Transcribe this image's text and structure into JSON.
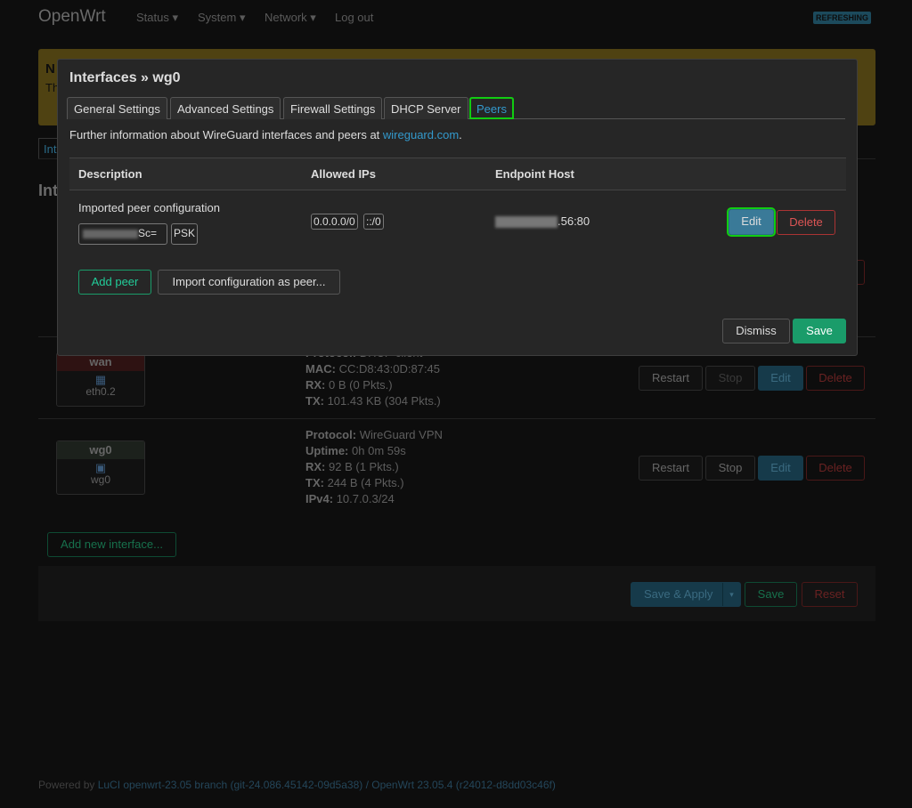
{
  "header": {
    "brand": "OpenWrt",
    "menu": [
      "Status ▾",
      "System ▾",
      "Network ▾",
      "Log out"
    ],
    "badge": "REFRESHING"
  },
  "background": {
    "notice_title": "N",
    "notice_text": "Th",
    "tab": "Int",
    "heading": "Int",
    "interfaces": [
      {
        "name": "wan",
        "device": "eth0.2",
        "header_color": "#8a2a2a",
        "details": [
          [
            "Protocol:",
            "DHCP client"
          ],
          [
            "MAC:",
            "CC:D8:43:0D:87:45"
          ],
          [
            "RX:",
            "0 B (0 Pkts.)"
          ],
          [
            "TX:",
            "101.43 KB (304 Pkts.)"
          ]
        ]
      },
      {
        "name": "wg0",
        "device": "wg0",
        "header_color": "#3a4a3a",
        "details": [
          [
            "Protocol:",
            "WireGuard VPN"
          ],
          [
            "Uptime:",
            "0h 0m 59s"
          ],
          [
            "RX:",
            "92 B (1 Pkts.)"
          ],
          [
            "TX:",
            "244 B (4 Pkts.)"
          ],
          [
            "IPv4:",
            "10.7.0.3/24"
          ]
        ]
      }
    ],
    "row_buttons": {
      "restart": "Restart",
      "stop": "Stop",
      "edit": "Edit",
      "delete": "Delete"
    },
    "add_interface": "Add new interface...",
    "save_apply": "Save & Apply",
    "save": "Save",
    "reset": "Reset",
    "footer": {
      "prefix": "Powered by ",
      "link": "LuCI openwrt-23.05 branch (git-24.086.45142-09d5a38) / OpenWrt 23.05.4 (r24012-d8dd03c46f)"
    }
  },
  "modal": {
    "title": "Interfaces » wg0",
    "tabs": [
      "General Settings",
      "Advanced Settings",
      "Firewall Settings",
      "DHCP Server",
      "Peers"
    ],
    "active_tab": "Peers",
    "info_text": "Further information about WireGuard interfaces and peers at ",
    "info_link": "wireguard.com",
    "info_end": ".",
    "columns": [
      "Description",
      "Allowed IPs",
      "Endpoint Host"
    ],
    "peer": {
      "description": "Imported peer configuration",
      "key_suffix": "Sc=",
      "psk": "PSK",
      "allowed_ips": [
        "0.0.0.0/0",
        "::/0"
      ],
      "endpoint_suffix": ".56:80",
      "edit": "Edit",
      "delete": "Delete"
    },
    "add_peer": "Add peer",
    "import_peer": "Import configuration as peer...",
    "dismiss": "Dismiss",
    "save": "Save"
  }
}
